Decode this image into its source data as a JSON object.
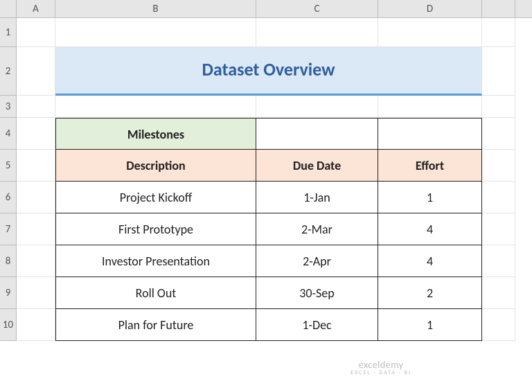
{
  "columns": {
    "A": "A",
    "B": "B",
    "C": "C",
    "D": "D",
    "E": ""
  },
  "rows": [
    "1",
    "2",
    "3",
    "4",
    "5",
    "6",
    "7",
    "8",
    "9",
    "10"
  ],
  "title": "Dataset Overview",
  "headers": {
    "milestones": "Milestones",
    "description": "Description",
    "due_date": "Due Date",
    "effort": "Effort"
  },
  "data": [
    {
      "description": "Project Kickoff",
      "due_date": "1-Jan",
      "effort": "1"
    },
    {
      "description": "First Prototype",
      "due_date": "2-Mar",
      "effort": "4"
    },
    {
      "description": "Investor Presentation",
      "due_date": "2-Apr",
      "effort": "4"
    },
    {
      "description": "Roll  Out",
      "due_date": "30-Sep",
      "effort": "2"
    },
    {
      "description": "Plan for Future",
      "due_date": "1-Dec",
      "effort": "1"
    }
  ],
  "watermark": {
    "brand": "exceldemy",
    "tagline": "EXCEL · DATA · BI"
  },
  "chart_data": {
    "type": "table",
    "title": "Dataset Overview",
    "columns": [
      "Description",
      "Due Date",
      "Effort"
    ],
    "rows": [
      [
        "Project Kickoff",
        "1-Jan",
        1
      ],
      [
        "First Prototype",
        "2-Mar",
        4
      ],
      [
        "Investor Presentation",
        "2-Apr",
        4
      ],
      [
        "Roll  Out",
        "30-Sep",
        2
      ],
      [
        "Plan for Future",
        "1-Dec",
        1
      ]
    ]
  }
}
